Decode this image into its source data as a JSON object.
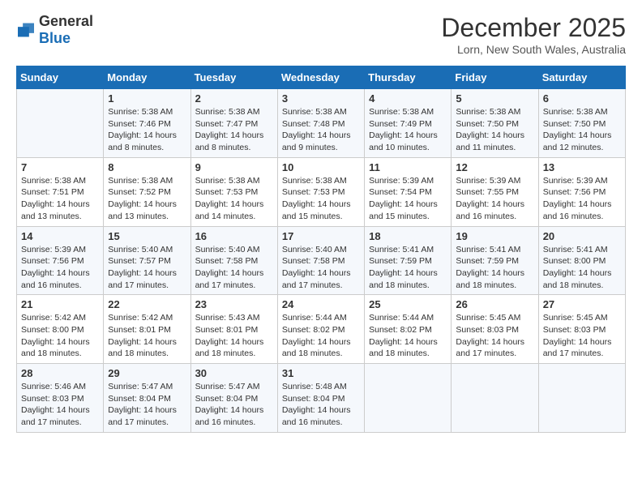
{
  "header": {
    "logo_general": "General",
    "logo_blue": "Blue",
    "month_title": "December 2025",
    "location": "Lorn, New South Wales, Australia"
  },
  "days_of_week": [
    "Sunday",
    "Monday",
    "Tuesday",
    "Wednesday",
    "Thursday",
    "Friday",
    "Saturday"
  ],
  "weeks": [
    [
      {
        "day": "",
        "sunrise": "",
        "sunset": "",
        "daylight": ""
      },
      {
        "day": "1",
        "sunrise": "Sunrise: 5:38 AM",
        "sunset": "Sunset: 7:46 PM",
        "daylight": "Daylight: 14 hours and 8 minutes."
      },
      {
        "day": "2",
        "sunrise": "Sunrise: 5:38 AM",
        "sunset": "Sunset: 7:47 PM",
        "daylight": "Daylight: 14 hours and 8 minutes."
      },
      {
        "day": "3",
        "sunrise": "Sunrise: 5:38 AM",
        "sunset": "Sunset: 7:48 PM",
        "daylight": "Daylight: 14 hours and 9 minutes."
      },
      {
        "day": "4",
        "sunrise": "Sunrise: 5:38 AM",
        "sunset": "Sunset: 7:49 PM",
        "daylight": "Daylight: 14 hours and 10 minutes."
      },
      {
        "day": "5",
        "sunrise": "Sunrise: 5:38 AM",
        "sunset": "Sunset: 7:50 PM",
        "daylight": "Daylight: 14 hours and 11 minutes."
      },
      {
        "day": "6",
        "sunrise": "Sunrise: 5:38 AM",
        "sunset": "Sunset: 7:50 PM",
        "daylight": "Daylight: 14 hours and 12 minutes."
      }
    ],
    [
      {
        "day": "7",
        "sunrise": "Sunrise: 5:38 AM",
        "sunset": "Sunset: 7:51 PM",
        "daylight": "Daylight: 14 hours and 13 minutes."
      },
      {
        "day": "8",
        "sunrise": "Sunrise: 5:38 AM",
        "sunset": "Sunset: 7:52 PM",
        "daylight": "Daylight: 14 hours and 13 minutes."
      },
      {
        "day": "9",
        "sunrise": "Sunrise: 5:38 AM",
        "sunset": "Sunset: 7:53 PM",
        "daylight": "Daylight: 14 hours and 14 minutes."
      },
      {
        "day": "10",
        "sunrise": "Sunrise: 5:38 AM",
        "sunset": "Sunset: 7:53 PM",
        "daylight": "Daylight: 14 hours and 15 minutes."
      },
      {
        "day": "11",
        "sunrise": "Sunrise: 5:39 AM",
        "sunset": "Sunset: 7:54 PM",
        "daylight": "Daylight: 14 hours and 15 minutes."
      },
      {
        "day": "12",
        "sunrise": "Sunrise: 5:39 AM",
        "sunset": "Sunset: 7:55 PM",
        "daylight": "Daylight: 14 hours and 16 minutes."
      },
      {
        "day": "13",
        "sunrise": "Sunrise: 5:39 AM",
        "sunset": "Sunset: 7:56 PM",
        "daylight": "Daylight: 14 hours and 16 minutes."
      }
    ],
    [
      {
        "day": "14",
        "sunrise": "Sunrise: 5:39 AM",
        "sunset": "Sunset: 7:56 PM",
        "daylight": "Daylight: 14 hours and 16 minutes."
      },
      {
        "day": "15",
        "sunrise": "Sunrise: 5:40 AM",
        "sunset": "Sunset: 7:57 PM",
        "daylight": "Daylight: 14 hours and 17 minutes."
      },
      {
        "day": "16",
        "sunrise": "Sunrise: 5:40 AM",
        "sunset": "Sunset: 7:58 PM",
        "daylight": "Daylight: 14 hours and 17 minutes."
      },
      {
        "day": "17",
        "sunrise": "Sunrise: 5:40 AM",
        "sunset": "Sunset: 7:58 PM",
        "daylight": "Daylight: 14 hours and 17 minutes."
      },
      {
        "day": "18",
        "sunrise": "Sunrise: 5:41 AM",
        "sunset": "Sunset: 7:59 PM",
        "daylight": "Daylight: 14 hours and 18 minutes."
      },
      {
        "day": "19",
        "sunrise": "Sunrise: 5:41 AM",
        "sunset": "Sunset: 7:59 PM",
        "daylight": "Daylight: 14 hours and 18 minutes."
      },
      {
        "day": "20",
        "sunrise": "Sunrise: 5:41 AM",
        "sunset": "Sunset: 8:00 PM",
        "daylight": "Daylight: 14 hours and 18 minutes."
      }
    ],
    [
      {
        "day": "21",
        "sunrise": "Sunrise: 5:42 AM",
        "sunset": "Sunset: 8:00 PM",
        "daylight": "Daylight: 14 hours and 18 minutes."
      },
      {
        "day": "22",
        "sunrise": "Sunrise: 5:42 AM",
        "sunset": "Sunset: 8:01 PM",
        "daylight": "Daylight: 14 hours and 18 minutes."
      },
      {
        "day": "23",
        "sunrise": "Sunrise: 5:43 AM",
        "sunset": "Sunset: 8:01 PM",
        "daylight": "Daylight: 14 hours and 18 minutes."
      },
      {
        "day": "24",
        "sunrise": "Sunrise: 5:44 AM",
        "sunset": "Sunset: 8:02 PM",
        "daylight": "Daylight: 14 hours and 18 minutes."
      },
      {
        "day": "25",
        "sunrise": "Sunrise: 5:44 AM",
        "sunset": "Sunset: 8:02 PM",
        "daylight": "Daylight: 14 hours and 18 minutes."
      },
      {
        "day": "26",
        "sunrise": "Sunrise: 5:45 AM",
        "sunset": "Sunset: 8:03 PM",
        "daylight": "Daylight: 14 hours and 17 minutes."
      },
      {
        "day": "27",
        "sunrise": "Sunrise: 5:45 AM",
        "sunset": "Sunset: 8:03 PM",
        "daylight": "Daylight: 14 hours and 17 minutes."
      }
    ],
    [
      {
        "day": "28",
        "sunrise": "Sunrise: 5:46 AM",
        "sunset": "Sunset: 8:03 PM",
        "daylight": "Daylight: 14 hours and 17 minutes."
      },
      {
        "day": "29",
        "sunrise": "Sunrise: 5:47 AM",
        "sunset": "Sunset: 8:04 PM",
        "daylight": "Daylight: 14 hours and 17 minutes."
      },
      {
        "day": "30",
        "sunrise": "Sunrise: 5:47 AM",
        "sunset": "Sunset: 8:04 PM",
        "daylight": "Daylight: 14 hours and 16 minutes."
      },
      {
        "day": "31",
        "sunrise": "Sunrise: 5:48 AM",
        "sunset": "Sunset: 8:04 PM",
        "daylight": "Daylight: 14 hours and 16 minutes."
      },
      {
        "day": "",
        "sunrise": "",
        "sunset": "",
        "daylight": ""
      },
      {
        "day": "",
        "sunrise": "",
        "sunset": "",
        "daylight": ""
      },
      {
        "day": "",
        "sunrise": "",
        "sunset": "",
        "daylight": ""
      }
    ]
  ]
}
